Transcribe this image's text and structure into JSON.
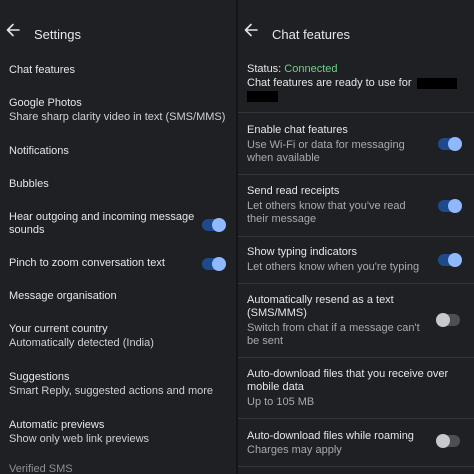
{
  "left": {
    "title": "Settings",
    "items": [
      {
        "label": "Chat features"
      },
      {
        "label": "Google Photos",
        "sub": "Share sharp clarity video in text (SMS/MMS)"
      },
      {
        "label": "Notifications"
      },
      {
        "label": "Bubbles"
      },
      {
        "label": "Hear outgoing and incoming message sounds",
        "toggle": true
      },
      {
        "label": "Pinch to zoom conversation text",
        "toggle": true
      },
      {
        "label": "Message organisation"
      },
      {
        "label": "Your current country",
        "sub": "Automatically detected (India)"
      },
      {
        "label": "Suggestions",
        "sub": "Smart Reply, suggested actions and more"
      },
      {
        "label": "Automatic previews",
        "sub": "Show only web link previews"
      },
      {
        "label": "Verified SMS"
      }
    ]
  },
  "right": {
    "title": "Chat features",
    "status_label": "Status: ",
    "status_value": "Connected",
    "status_desc": "Chat features are ready to use for",
    "items": [
      {
        "label": "Enable chat features",
        "sub": "Use Wi-Fi or data for messaging when available",
        "toggle": true
      },
      {
        "label": "Send read receipts",
        "sub": "Let others know that you've read their message",
        "toggle": true
      },
      {
        "label": "Show typing indicators",
        "sub": "Let others know when you're typing",
        "toggle": true
      },
      {
        "label": "Automatically resend as a text (SMS/MMS)",
        "sub": "Switch from chat if a message can't be sent",
        "toggle": false
      },
      {
        "label": "Auto-download files that you receive over mobile data",
        "sub": "Up to 105 MB"
      },
      {
        "label": "Auto-download files while roaming",
        "sub": "Charges may apply",
        "toggle": false
      }
    ]
  },
  "colors": {
    "background": "#1f2023",
    "accent_toggle": "#8fb8ff",
    "status_connected": "#6fcf88"
  }
}
